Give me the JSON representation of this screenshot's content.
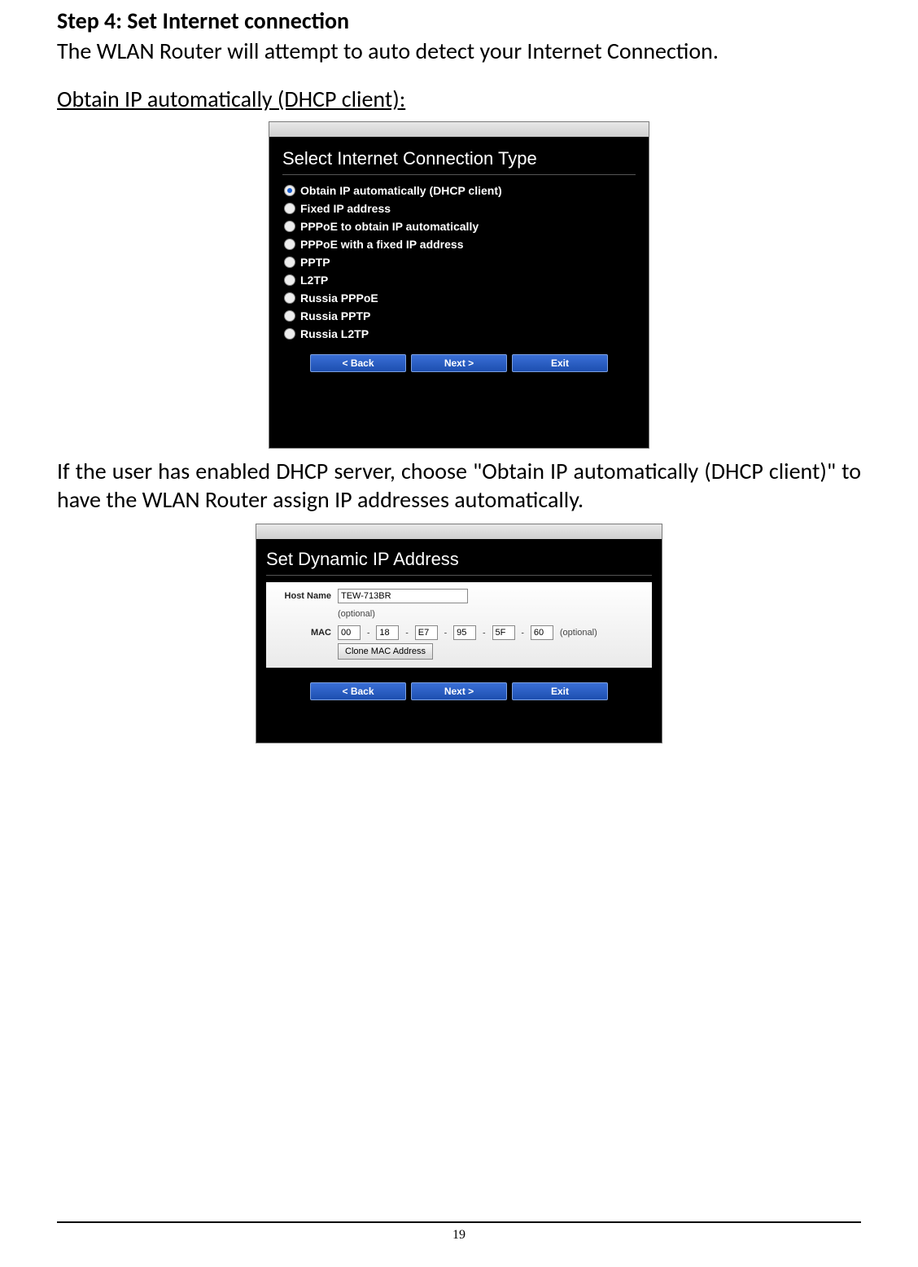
{
  "step_title": "Step 4: Set Internet connection",
  "step_desc": "The WLAN Router will attempt to auto detect your Internet Connection.",
  "sub_heading": "Obtain IP automatically (DHCP client):",
  "panel1": {
    "title": "Select Internet Connection Type",
    "options": [
      "Obtain IP automatically (DHCP client)",
      "Fixed IP address",
      "PPPoE to obtain IP automatically",
      "PPPoE with a fixed IP address",
      "PPTP",
      "L2TP",
      "Russia PPPoE",
      "Russia PPTP",
      "Russia L2TP"
    ],
    "selected_index": 0,
    "buttons": {
      "back": "< Back",
      "next": "Next >",
      "exit": "Exit"
    }
  },
  "body_para": "If the user has enabled DHCP server, choose \"Obtain IP automatically (DHCP client)\" to have the WLAN Router assign IP addresses automatically.",
  "panel2": {
    "title": "Set Dynamic IP Address",
    "host_label": "Host Name",
    "host_value": "TEW-713BR",
    "optional": "(optional)",
    "mac_label": "MAC",
    "mac": [
      "00",
      "18",
      "E7",
      "95",
      "5F",
      "60"
    ],
    "clone_label": "Clone MAC Address",
    "buttons": {
      "back": "< Back",
      "next": "Next >",
      "exit": "Exit"
    }
  },
  "page_number": "19"
}
